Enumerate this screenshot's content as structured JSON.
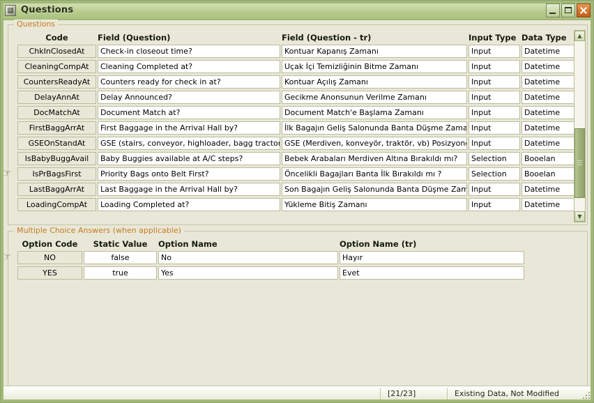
{
  "window": {
    "title": "Questions",
    "icon": "app-icon",
    "controls": {
      "minimize": "minimize-button",
      "maximize": "maximize-button",
      "close": "close-button"
    }
  },
  "questions_group": {
    "caption": "Questions",
    "columns": [
      "Code",
      "Field (Question)",
      "Field (Question - tr)",
      "Input Type",
      "Data Type"
    ],
    "rows": [
      {
        "code": "ChkInClosedAt",
        "question": "Check-in closeout time?",
        "question_tr": "Kontuar Kapanış Zamanı",
        "input_type": "Input",
        "data_type": "Datetime",
        "selected": false
      },
      {
        "code": "CleaningCompAt",
        "question": "Cleaning Completed at?",
        "question_tr": "Uçak İçi Temizliğinin Bitme Zamanı",
        "input_type": "Input",
        "data_type": "Datetime",
        "selected": false
      },
      {
        "code": "CountersReadyAt",
        "question": "Counters ready for check in at?",
        "question_tr": "Kontuar Açılış Zamanı",
        "input_type": "Input",
        "data_type": "Datetime",
        "selected": false
      },
      {
        "code": "DelayAnnAt",
        "question": "Delay Announced?",
        "question_tr": "Gecikme Anonsunun Verilme Zamanı",
        "input_type": "Input",
        "data_type": "Datetime",
        "selected": false
      },
      {
        "code": "DocMatchAt",
        "question": "Document Match at?",
        "question_tr": "Document Match'e Başlama Zamanı",
        "input_type": "Input",
        "data_type": "Datetime",
        "selected": false
      },
      {
        "code": "FirstBaggArrAt",
        "question": "First Baggage in the Arrival Hall by?",
        "question_tr": "İlk Bagajın Geliş Salonunda Banta Düşme Zamanı",
        "input_type": "Input",
        "data_type": "Datetime",
        "selected": false
      },
      {
        "code": "GSEOnStandAt",
        "question": "GSE (stairs, conveyor, highloader, bagg tractor-carts,",
        "question_tr": "GSE (Merdiven, konveyör, traktör, vb) Posizyonda Haz",
        "input_type": "Input",
        "data_type": "Datetime",
        "selected": false
      },
      {
        "code": "IsBabyBuggAvail",
        "question": "Baby Buggies available at A/C steps?",
        "question_tr": "Bebek Arabaları Merdiven Altına Bırakıldı mı?",
        "input_type": "Selection",
        "data_type": "Booelan",
        "selected": false
      },
      {
        "code": "IsPrBagsFirst",
        "question": "Priority Bags onto Belt First?",
        "question_tr": "Öncelikli Bagajları Banta İlk Bırakıldı mı ?",
        "input_type": "Selection",
        "data_type": "Booelan",
        "selected": true
      },
      {
        "code": "LastBaggArrAt",
        "question": "Last Baggage in the Arrival Hall by?",
        "question_tr": "Son Bagajın Geliş Salonunda Banta Düşme Zamanı",
        "input_type": "Input",
        "data_type": "Datetime",
        "selected": false
      },
      {
        "code": "LoadingCompAt",
        "question": "Loading Completed at?",
        "question_tr": "Yükleme Bitiş Zamanı",
        "input_type": "Input",
        "data_type": "Datetime",
        "selected": false
      }
    ],
    "scrollbar": {
      "up_glyph": "▲",
      "down_glyph": "▼"
    }
  },
  "answers_group": {
    "caption": "Multiple Choice Answers (when applicable)",
    "columns": [
      "Option Code",
      "Static Value",
      "Option Name",
      "Option Name (tr)"
    ],
    "rows": [
      {
        "option_code": "NO",
        "static_value": "false",
        "option_name": "No",
        "option_name_tr": "Hayır",
        "selected": true
      },
      {
        "option_code": "YES",
        "static_value": "true",
        "option_name": "Yes",
        "option_name_tr": "Evet",
        "selected": false
      }
    ]
  },
  "statusbar": {
    "record_counter": "[21/23]",
    "state": "Existing Data, Not Modified"
  },
  "colors": {
    "frame": "#a2b878",
    "titlebar_top": "#d7e3bc",
    "titlebar_bottom": "#a8c07c",
    "client_bg": "#e9e8d8",
    "group_caption": "#c47a23",
    "close_button": "#d9782f",
    "grid_cell_border": "#b9bc9b",
    "scroll_thumb": "#9db078"
  }
}
